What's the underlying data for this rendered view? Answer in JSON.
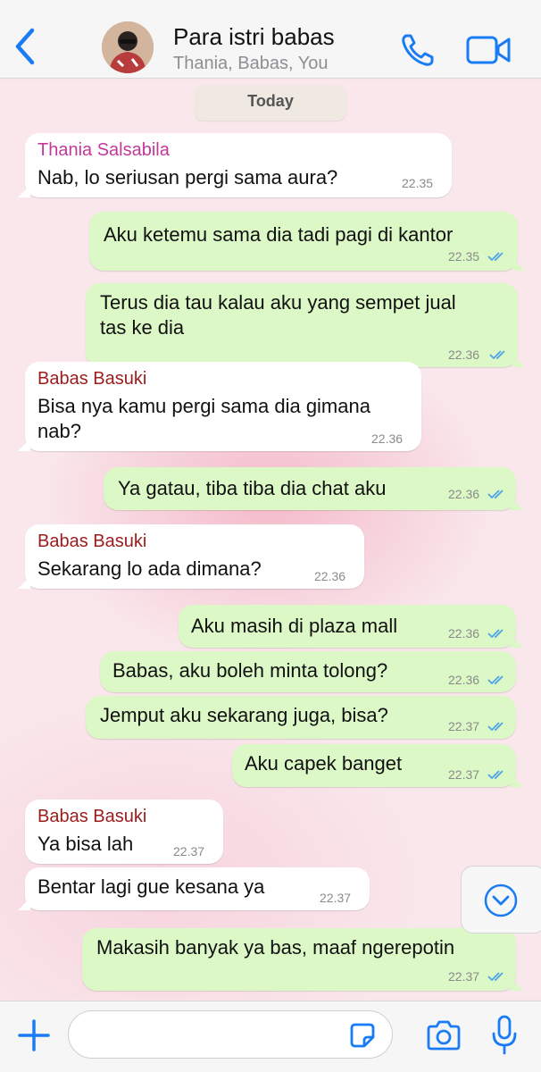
{
  "header": {
    "title": "Para istri babas",
    "subtitle": "Thania, Babas, You"
  },
  "date_label": "Today",
  "messages": [
    {
      "dir": "in",
      "sender": "Thania Salsabila",
      "sender_color": "#c2399a",
      "text": "Nab, lo seriusan pergi sama aura?",
      "time": "22.35"
    },
    {
      "dir": "out",
      "text": "Aku ketemu sama dia tadi pagi di kantor",
      "time": "22.35",
      "status": "read"
    },
    {
      "dir": "out",
      "text": "Terus dia tau kalau aku yang sempet jual",
      "text2": "tas ke dia",
      "time": "22.36",
      "status": "read"
    },
    {
      "dir": "in",
      "sender": "Babas Basuki",
      "sender_color": "#9b1c1c",
      "text": "Bisa nya kamu pergi sama dia gimana",
      "text2": "nab?",
      "time": "22.36"
    },
    {
      "dir": "out",
      "text": "Ya gatau, tiba tiba dia chat aku",
      "time": "22.36",
      "status": "read"
    },
    {
      "dir": "in",
      "sender": "Babas Basuki",
      "sender_color": "#9b1c1c",
      "text": "Sekarang lo ada dimana?",
      "time": "22.36"
    },
    {
      "dir": "out",
      "text": "Aku masih di plaza mall",
      "time": "22.36",
      "status": "read"
    },
    {
      "dir": "out",
      "text": "Babas, aku boleh minta tolong?",
      "time": "22.36",
      "status": "read"
    },
    {
      "dir": "out",
      "text": "Jemput aku sekarang juga, bisa?",
      "time": "22.37",
      "status": "read"
    },
    {
      "dir": "out",
      "text": "Aku capek banget",
      "time": "22.37",
      "status": "read"
    },
    {
      "dir": "in",
      "sender": "Babas Basuki",
      "sender_color": "#9b1c1c",
      "text": "Ya bisa lah",
      "time": "22.37"
    },
    {
      "dir": "in",
      "text": "Bentar lagi gue kesana ya",
      "time": "22.37"
    },
    {
      "dir": "out",
      "text": "Makasih banyak ya bas, maaf ngerepotin",
      "time": "22.37",
      "status": "read"
    }
  ],
  "colors": {
    "accent": "#1a7cf5",
    "read_ticks": "#4fa3e8",
    "outgoing_bubble": "#dcf8c6",
    "incoming_bubble": "#ffffff"
  },
  "icons": {
    "back": "chevron-left-icon",
    "call": "phone-icon",
    "video": "video-camera-icon",
    "scroll": "chevron-down-circle-icon",
    "plus": "plus-icon",
    "sticker": "sticker-icon",
    "camera": "camera-icon",
    "mic": "microphone-icon"
  },
  "input": {
    "value": "",
    "placeholder": ""
  }
}
